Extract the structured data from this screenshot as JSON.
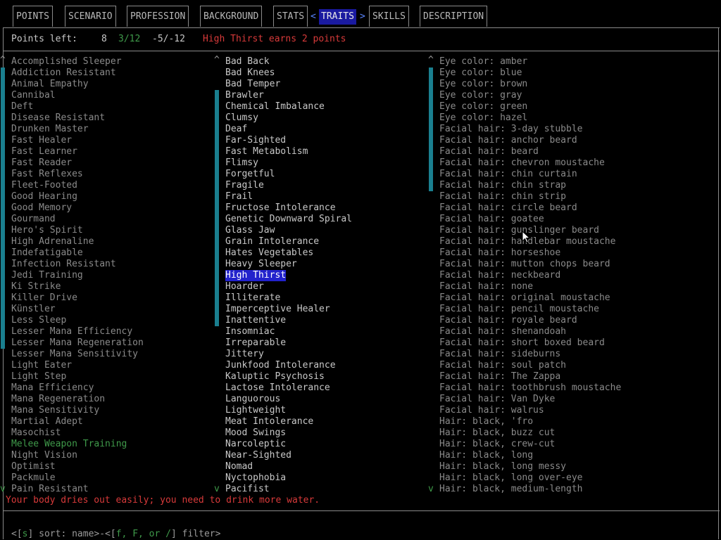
{
  "tabs": [
    {
      "label": "POINTS"
    },
    {
      "label": "SCENARIO"
    },
    {
      "label": "PROFESSION"
    },
    {
      "label": "BACKGROUND"
    },
    {
      "label": "STATS"
    },
    {
      "label": "TRAITS"
    },
    {
      "label": "SKILLS"
    },
    {
      "label": "DESCRIPTION"
    }
  ],
  "nav": {
    "left_arrow": "<",
    "right_arrow": ">"
  },
  "points_bar": {
    "label": "Points left:",
    "points": "8",
    "ratio": "3/12",
    "negative": "-5/-12",
    "message": "High Thirst earns 2 points"
  },
  "scroll_marks": {
    "up": "^",
    "down": "v"
  },
  "positive_traits": [
    "Accomplished Sleeper",
    "Addiction Resistant",
    "Animal Empathy",
    "Cannibal",
    "Deft",
    "Disease Resistant",
    "Drunken Master",
    "Fast Healer",
    "Fast Learner",
    "Fast Reader",
    "Fast Reflexes",
    "Fleet-Footed",
    "Good Hearing",
    "Good Memory",
    "Gourmand",
    "Hero's Spirit",
    "High Adrenaline",
    "Indefatigable",
    "Infection Resistant",
    "Jedi Training",
    "Ki Strike",
    "Killer Drive",
    "Künstler",
    "Less Sleep",
    "Lesser Mana Efficiency",
    "Lesser Mana Regeneration",
    "Lesser Mana Sensitivity",
    "Light Eater",
    "Light Step",
    "Mana Efficiency",
    "Mana Regeneration",
    "Mana Sensitivity",
    "Martial Adept",
    "Masochist",
    "Melee Weapon Training",
    "Night Vision",
    "Optimist",
    "Packmule",
    "Pain Resistant"
  ],
  "positive_highlight": "Melee Weapon Training",
  "negative_traits": [
    "Bad Back",
    "Bad Knees",
    "Bad Temper",
    "Brawler",
    "Chemical Imbalance",
    "Clumsy",
    "Deaf",
    "Far-Sighted",
    "Fast Metabolism",
    "Flimsy",
    "Forgetful",
    "Fragile",
    "Frail",
    "Fructose Intolerance",
    "Genetic Downward Spiral",
    "Glass Jaw",
    "Grain Intolerance",
    "Hates Vegetables",
    "Heavy Sleeper",
    "High Thirst",
    "Hoarder",
    "Illiterate",
    "Imperceptive Healer",
    "Inattentive",
    "Insomniac",
    "Irreparable",
    "Jittery",
    "Junkfood Intolerance",
    "Kaluptic Psychosis",
    "Lactose Intolerance",
    "Languorous",
    "Lightweight",
    "Meat Intolerance",
    "Mood Swings",
    "Narcoleptic",
    "Near-Sighted",
    "Nomad",
    "Nyctophobia",
    "Pacifist"
  ],
  "negative_selected": "High Thirst",
  "neutral_traits": [
    "Eye color: amber",
    "Eye color: blue",
    "Eye color: brown",
    "Eye color: gray",
    "Eye color: green",
    "Eye color: hazel",
    "Facial hair: 3-day stubble",
    "Facial hair: anchor beard",
    "Facial hair: beard",
    "Facial hair: chevron moustache",
    "Facial hair: chin curtain",
    "Facial hair: chin strap",
    "Facial hair: chin strip",
    "Facial hair: circle beard",
    "Facial hair: goatee",
    "Facial hair: gunslinger beard",
    "Facial hair: handlebar moustache",
    "Facial hair: horseshoe",
    "Facial hair: mutton chops beard",
    "Facial hair: neckbeard",
    "Facial hair: none",
    "Facial hair: original moustache",
    "Facial hair: pencil moustache",
    "Facial hair: royale beard",
    "Facial hair: shenandoah",
    "Facial hair: short boxed beard",
    "Facial hair: sideburns",
    "Facial hair: soul patch",
    "Facial hair: The Zappa",
    "Facial hair: toothbrush moustache",
    "Facial hair: Van Dyke",
    "Facial hair: walrus",
    "Hair: black, 'fro",
    "Hair: black, buzz cut",
    "Hair: black, crew-cut",
    "Hair: black, long",
    "Hair: black, long messy",
    "Hair: black, long over-eye",
    "Hair: black, medium-length"
  ],
  "description": "Your body dries out easily; you need to drink more water.",
  "footer": {
    "sort_open": "<[",
    "sort_key": "s",
    "sort_text": "] sort: name>-<[",
    "filter_keys": "f, F, or /",
    "filter_text": "] filter>"
  },
  "colors": {
    "accent": "#2222cc",
    "scroll": "#1a7f8f",
    "warning": "#d83a3a",
    "positive": "#3f9a4a"
  }
}
